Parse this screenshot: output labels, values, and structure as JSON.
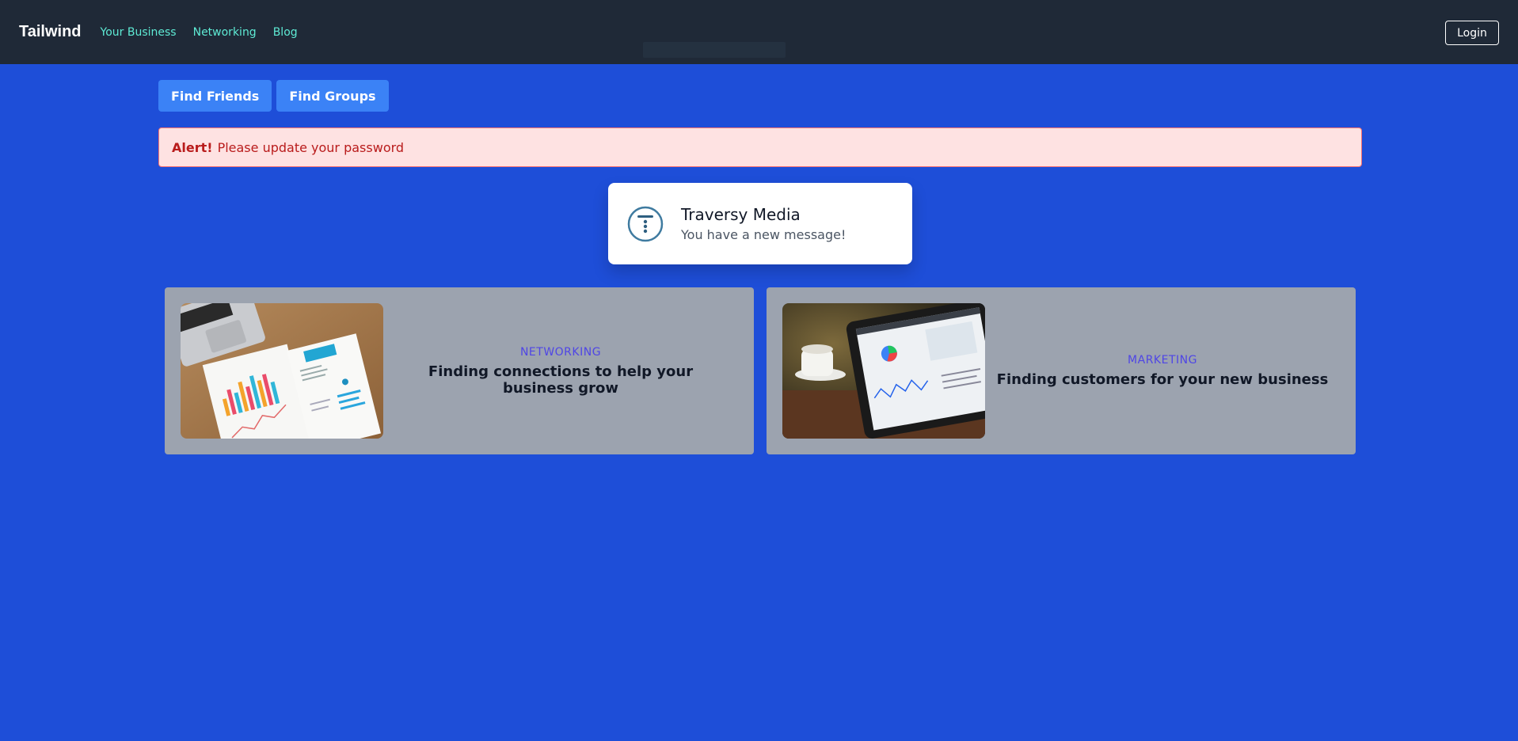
{
  "navbar": {
    "brand": "Tailwind",
    "links": [
      "Your Business",
      "Networking",
      "Blog"
    ],
    "login_label": "Login"
  },
  "actions": {
    "buttons": [
      "Find Friends",
      "Find Groups"
    ]
  },
  "alert": {
    "label": "Alert!",
    "message": "Please update your password"
  },
  "notification": {
    "logo_icon": "traversy-logo-icon",
    "title": "Traversy Media",
    "message": "You have a new message!"
  },
  "cards": [
    {
      "image_icon": "analytics-papers-image",
      "category": "NETWORKING",
      "title": "Finding connections to help your business grow"
    },
    {
      "image_icon": "tablet-dashboard-image",
      "category": "MARKETING",
      "title": "Finding customers for your new business"
    }
  ],
  "colors": {
    "page_bg": "#1e4ed8",
    "navbar_bg": "#1f2937",
    "nav_link": "#5eead4",
    "button_bg": "#3b82f6",
    "alert_bg": "#fee2e2",
    "alert_text": "#b91c1c",
    "card_bg": "#9ca3af",
    "category_text": "#4f46e5"
  }
}
